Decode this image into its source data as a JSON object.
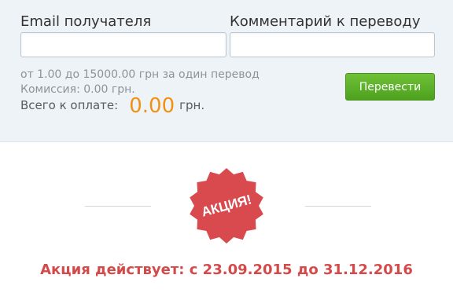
{
  "form": {
    "email_label": "Email получателя",
    "email_value": "",
    "comment_label": "Комментарий к переводу",
    "comment_value": "",
    "limits_text": "от 1.00 до 15000.00 грн за один перевод",
    "commission_text": "Комиссия: 0.00 грн.",
    "total_label": "Всего к оплате:",
    "total_amount": "0.00",
    "total_currency": "грн.",
    "submit_label": "Перевести"
  },
  "promo": {
    "badge_label": "АКЦИЯ!",
    "badge_color": "#d94a4f",
    "period_text": "Акция действует: с 23.09.2015 до 31.12.2016"
  },
  "colors": {
    "panel_bg": "#eef3f7",
    "amount": "#f29111",
    "button": "#5cb125",
    "promo_text": "#d44a4a"
  }
}
